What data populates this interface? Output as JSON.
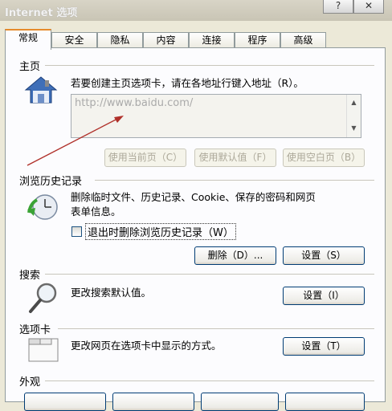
{
  "window": {
    "title": "Internet 选项",
    "help_button": "?",
    "close_button": "✕"
  },
  "tabs": [
    "常规",
    "安全",
    "隐私",
    "内容",
    "连接",
    "程序",
    "高级"
  ],
  "homepage": {
    "section_label": "主页",
    "instruction": "若要创建主页选项卡，请在各地址行键入地址（R）。",
    "url_value": "http://www.baidu.com/",
    "buttons": [
      "使用当前页（C）",
      "使用默认值（F）",
      "使用空白页（B）"
    ]
  },
  "history": {
    "section_label": "浏览历史记录",
    "description_line1": "删除临时文件、历史记录、Cookie、保存的密码和网页",
    "description_line2": "表单信息。",
    "checkbox_label": "退出时删除浏览历史记录（W）",
    "checkbox_checked": false,
    "delete_button": "删除（D）...",
    "settings_button": "设置（S）"
  },
  "search": {
    "section_label": "搜索",
    "description": "更改搜索默认值。",
    "settings_button": "设置（I）"
  },
  "tabs_section": {
    "section_label": "选项卡",
    "description": "更改网页在选项卡中显示的方式。",
    "settings_button": "设置（T）"
  },
  "appearance": {
    "section_label": "外观"
  },
  "colors": {
    "accent_tab": "#e68b2c",
    "button_border": "#003c74",
    "arrow": "#b0302a"
  }
}
